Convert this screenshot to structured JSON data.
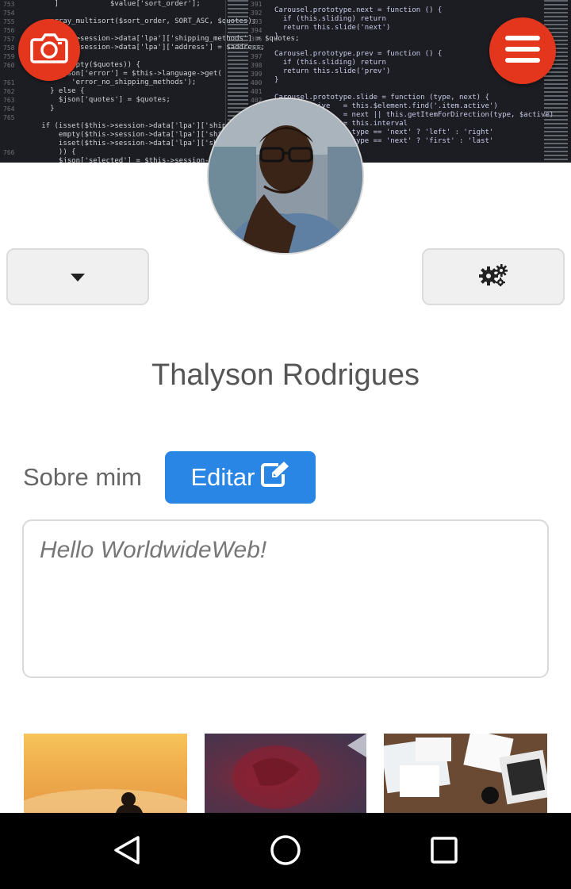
{
  "profile": {
    "name": "Thalyson Rodrigues"
  },
  "about": {
    "label": "Sobre mim",
    "edit_label": "Editar",
    "bio": "Hello WorldwideWeb!"
  },
  "colors": {
    "accent_red": "#e3361d",
    "edit_blue": "#2a86e4"
  },
  "icons": {
    "camera": "camera-icon",
    "menu": "hamburger-menu-icon",
    "dropdown": "caret-down-icon",
    "settings": "gears-icon",
    "edit": "edit-square-icon",
    "nav_back": "back-triangle-icon",
    "nav_home": "home-circle-icon",
    "nav_recent": "recent-square-icon"
  }
}
